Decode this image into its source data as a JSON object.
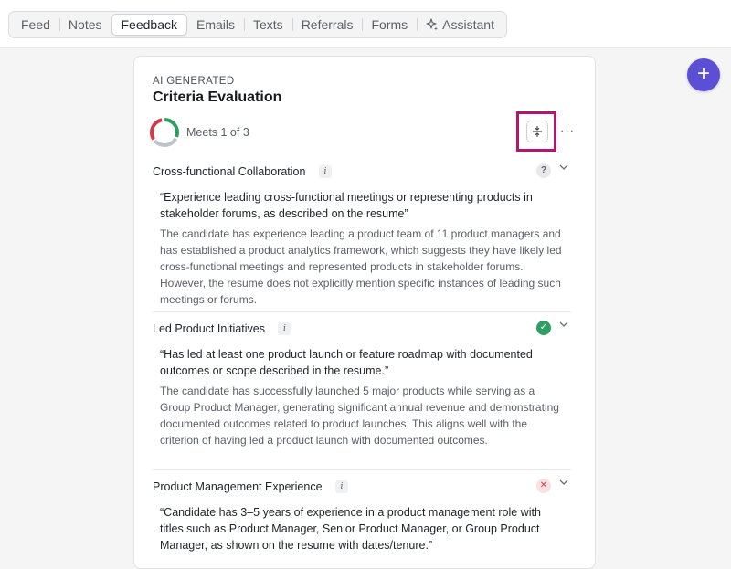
{
  "tabs": [
    {
      "label": "Feed"
    },
    {
      "label": "Notes"
    },
    {
      "label": "Feedback",
      "active": true
    },
    {
      "label": "Emails"
    },
    {
      "label": "Texts"
    },
    {
      "label": "Referrals"
    },
    {
      "label": "Forms"
    },
    {
      "label": "Assistant",
      "icon": "sparkle-icon"
    }
  ],
  "fab": {
    "label": "+"
  },
  "card": {
    "eyebrow": "AI GENERATED",
    "title": "Criteria Evaluation",
    "summary": "Meets 1 of 3",
    "progress": {
      "met": 1,
      "total": 3,
      "colors": {
        "met": "#2f9e62",
        "unknown": "#c0c2c7",
        "notmet": "#d13a48"
      }
    },
    "more_label": "···"
  },
  "criteria": [
    {
      "name": "Cross-functional Collaboration",
      "info": "i",
      "status": "unknown",
      "status_symbol": "?",
      "quote": "“Experience leading cross-functional meetings or representing products in stakeholder forums, as described on the resume”",
      "reasoning": "The candidate has experience leading a product team of 11 product managers and has established a product analytics framework, which suggests they have likely led cross-functional meetings and represented products in stakeholder forums. However, the resume does not explicitly mention specific instances of leading such meetings or forums."
    },
    {
      "name": "Led Product Initiatives",
      "info": "i",
      "status": "met",
      "status_symbol": "✓",
      "quote": "“Has led at least one product launch or feature roadmap with documented outcomes or scope described in the resume.”",
      "reasoning": "The candidate has successfully launched 5 major products while serving as a Group Product Manager, generating significant annual revenue and demonstrating documented outcomes related to product launches. This aligns well with the criterion of having led a product launch with documented outcomes."
    },
    {
      "name": "Product Management Experience",
      "info": "i",
      "status": "notmet",
      "status_symbol": "✕",
      "quote": "“Candidate has 3–5 years of experience in a product management role with titles such as Product Manager, Senior Product Manager, or Group Product Manager, as shown on the resume with dates/tenure.”",
      "reasoning": ""
    }
  ]
}
